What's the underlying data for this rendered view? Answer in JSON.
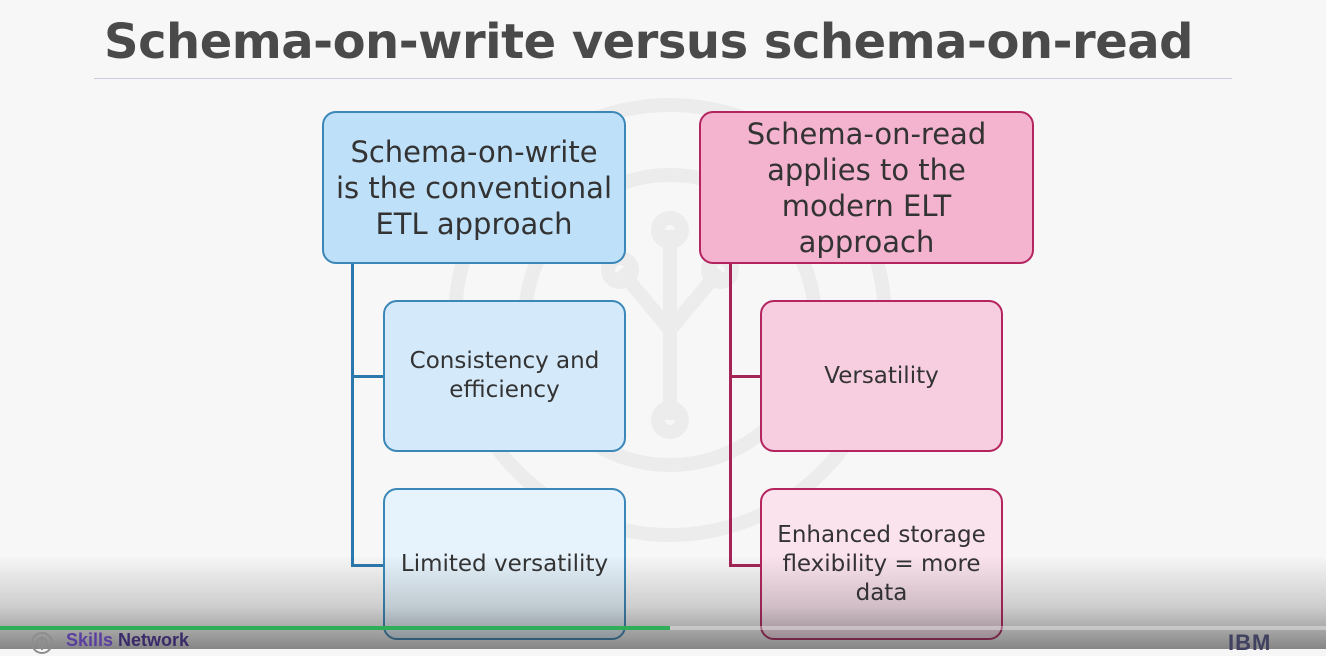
{
  "slide": {
    "title": "Schema-on-write versus schema-on-read"
  },
  "left_column": {
    "header_lines": [
      "Schema-on-write",
      "is the conventional",
      "ETL approach"
    ],
    "items": [
      {
        "lines": [
          "Consistency and",
          "efficiency"
        ]
      },
      {
        "lines": [
          "Limited versatility"
        ]
      }
    ]
  },
  "right_column": {
    "header_lines": [
      "Schema-on-read",
      "applies to the",
      "modern ELT",
      "approach"
    ],
    "items": [
      {
        "lines": [
          "Versatility"
        ]
      },
      {
        "lines": [
          "Enhanced storage",
          "flexibility = more",
          "data"
        ]
      }
    ]
  },
  "footer": {
    "brand_skills": "Skills",
    "brand_network": "Network",
    "corporate_logo": "IBM",
    "progress": 0.505
  },
  "colors": {
    "left_border": "#3a87b8",
    "right_border": "#b4245f",
    "progress": "#2fae5a"
  }
}
